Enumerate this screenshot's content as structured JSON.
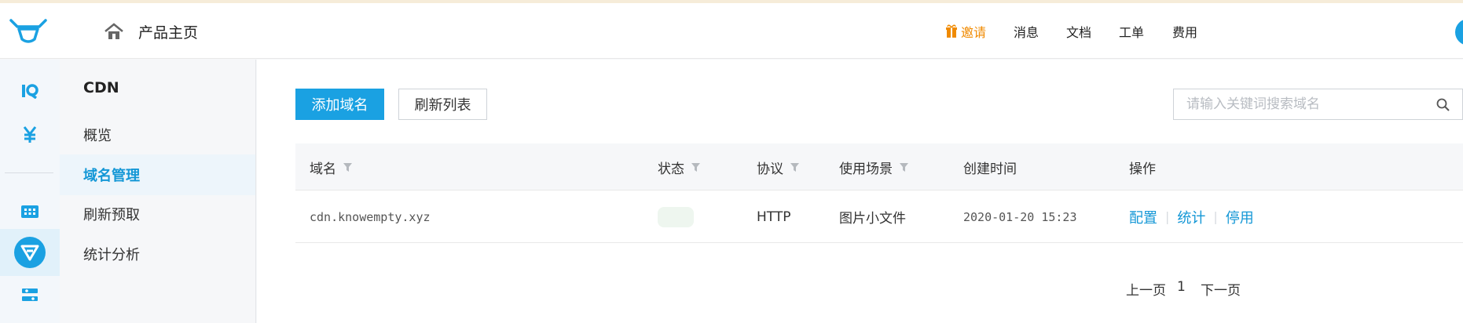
{
  "header": {
    "home_label": "产品主页",
    "nav": {
      "invite": "邀请",
      "messages": "消息",
      "docs": "文档",
      "tickets": "工单",
      "billing": "费用"
    }
  },
  "sidebar": {
    "product_title": "CDN",
    "items": [
      {
        "label": "概览"
      },
      {
        "label": "域名管理"
      },
      {
        "label": "刷新预取"
      },
      {
        "label": "统计分析"
      }
    ]
  },
  "toolbar": {
    "add_label": "添加域名",
    "refresh_label": "刷新列表",
    "search_placeholder": "请输入关键词搜索域名"
  },
  "table": {
    "columns": {
      "domain": "域名",
      "status": "状态",
      "protocol": "协议",
      "scenario": "使用场景",
      "created": "创建时间",
      "actions": "操作"
    },
    "rows": [
      {
        "domain": "cdn.knowempty.xyz",
        "protocol": "HTTP",
        "scenario": "图片小文件",
        "created": "2020-01-20 15:23",
        "actions": {
          "config": "配置",
          "stats": "统计",
          "disable": "停用"
        }
      }
    ]
  },
  "pagination": {
    "prev": "上一页",
    "current": "1",
    "next": "下一页"
  },
  "colors": {
    "accent": "#1aa1e2",
    "link": "#1497d6",
    "invite": "#f08a00"
  }
}
